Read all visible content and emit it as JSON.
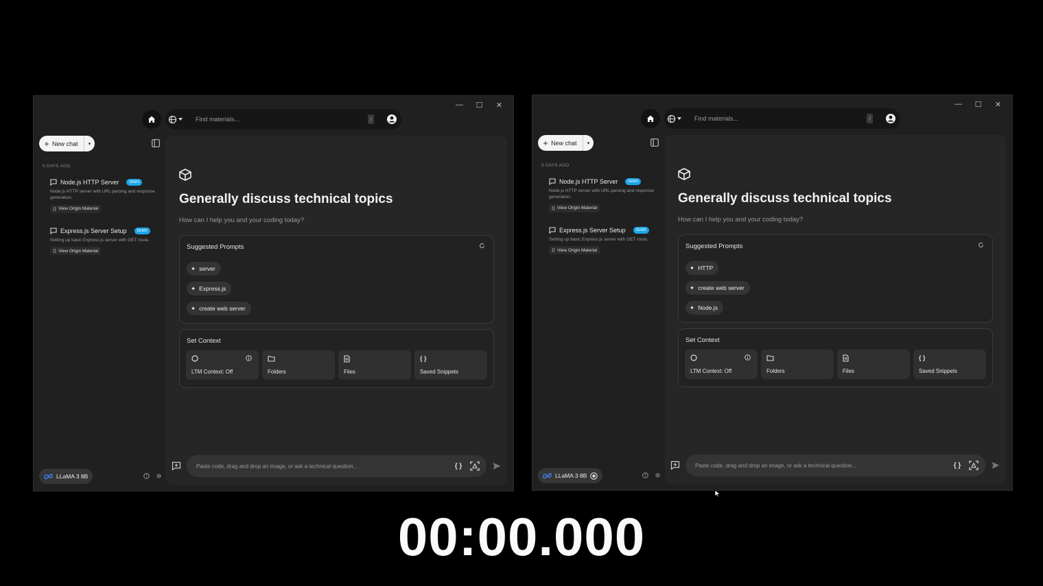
{
  "window_controls": {
    "minimize": "—",
    "maximize": "☐",
    "close": "✕"
  },
  "search": {
    "placeholder": "Find materials...",
    "shortcut": "/"
  },
  "sidebar": {
    "new_chat": "New chat",
    "section_label": "5 DAYS AGO",
    "chats": [
      {
        "title": "Node.js HTTP Server",
        "badge": "DEMO",
        "desc": "Node.js HTTP server with URL parsing and response generation.",
        "origin": "View Origin Material"
      },
      {
        "title": "Express.js Server Setup",
        "badge": "DEMO",
        "desc": "Setting up basic Express.js server with GET route.",
        "origin": "View Origin Material"
      }
    ],
    "model": "LLaMA 3 8B"
  },
  "main": {
    "title": "Generally discuss technical topics",
    "subtitle": "How can I help you and your coding today?",
    "suggested_title": "Suggested Prompts",
    "context_title": "Set Context",
    "context_buttons": [
      "LTM Context: Off",
      "Folders",
      "Files",
      "Saved Snippets"
    ],
    "composer_placeholder": "Paste code, drag and drop an image, or ask a technical question..."
  },
  "windows": [
    {
      "prompts": [
        "server",
        "Express.js",
        "create web server"
      ]
    },
    {
      "prompts": [
        "HTTP",
        "create web server",
        "Node.js"
      ]
    }
  ],
  "timer": "00:00.000",
  "colors": {
    "background": "#000000",
    "window": "#202020",
    "panel": "#262626",
    "badge": "#1da5e8"
  }
}
